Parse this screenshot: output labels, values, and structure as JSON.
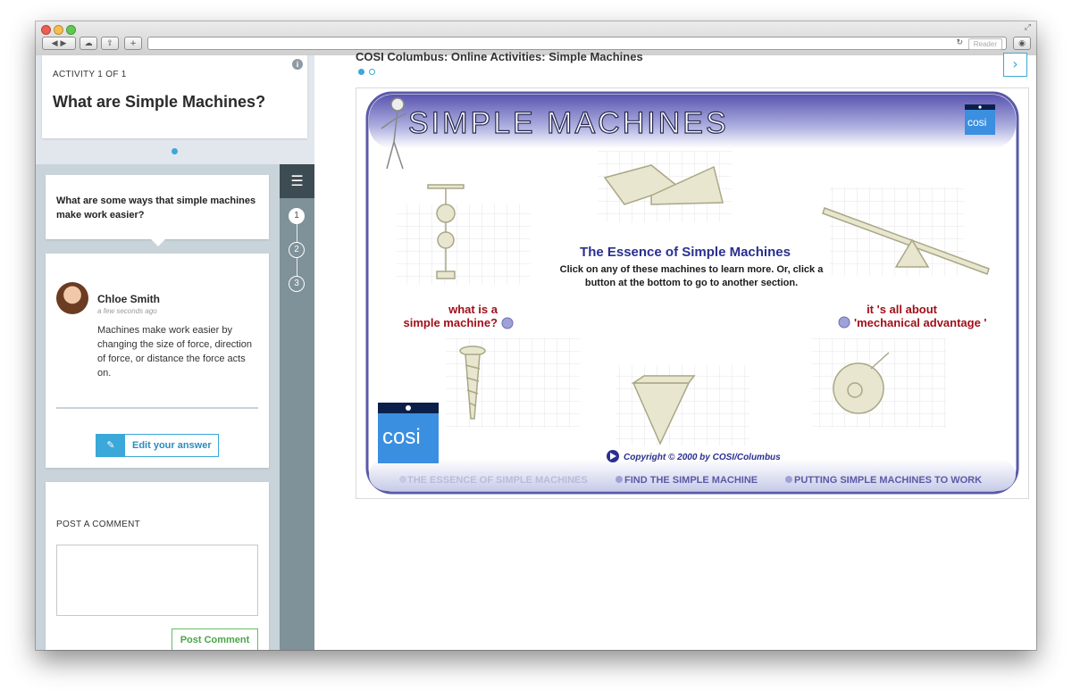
{
  "browser": {
    "reader_label": "Reader",
    "nav_back": "◀",
    "nav_forward": "▶",
    "add_tab": "+"
  },
  "sidebar": {
    "activity_label": "ACTIVITY 1 OF 1",
    "activity_title": "What are Simple Machines?",
    "question": "What are some ways that simple machines make work easier?",
    "answer": {
      "author": "Chloe Smith",
      "time": "a few seconds ago",
      "text": "Machines make work easier by changing the size of force, direction of force, or distance the force acts on.",
      "edit_label": "Edit your answer"
    },
    "comment": {
      "label": "POST A COMMENT",
      "placeholder": "",
      "button": "Post Comment"
    },
    "steps": [
      "1",
      "2",
      "3"
    ]
  },
  "main": {
    "title": "COSI Columbus: Online Activities: Simple Machines",
    "pages": 2,
    "current_page": 1
  },
  "flash": {
    "banner_title": "SIMPLE MACHINES",
    "logo_text": "cosi",
    "heading": "The Essence of Simple Machines",
    "intro_line1": "Click on any of these machines to learn more. Or, click a",
    "intro_line2": "button at the bottom to go to another section.",
    "link_left_line1": "what  is a",
    "link_left_line2": "simple machine?",
    "link_right_line1": "it 's all about",
    "link_right_line2": "'mechanical advantage '",
    "copyright": "Copyright © 2000 by COSI/Columbus",
    "nav": [
      "THE ESSENCE OF SIMPLE MACHINES",
      "FIND THE SIMPLE MACHINE",
      "PUTTING SIMPLE MACHINES TO WORK"
    ],
    "colors": {
      "heading": "#2a2f8f",
      "link": "#a0101a",
      "frame": "#5a5aa8",
      "logo": "#3b8fe0"
    }
  }
}
